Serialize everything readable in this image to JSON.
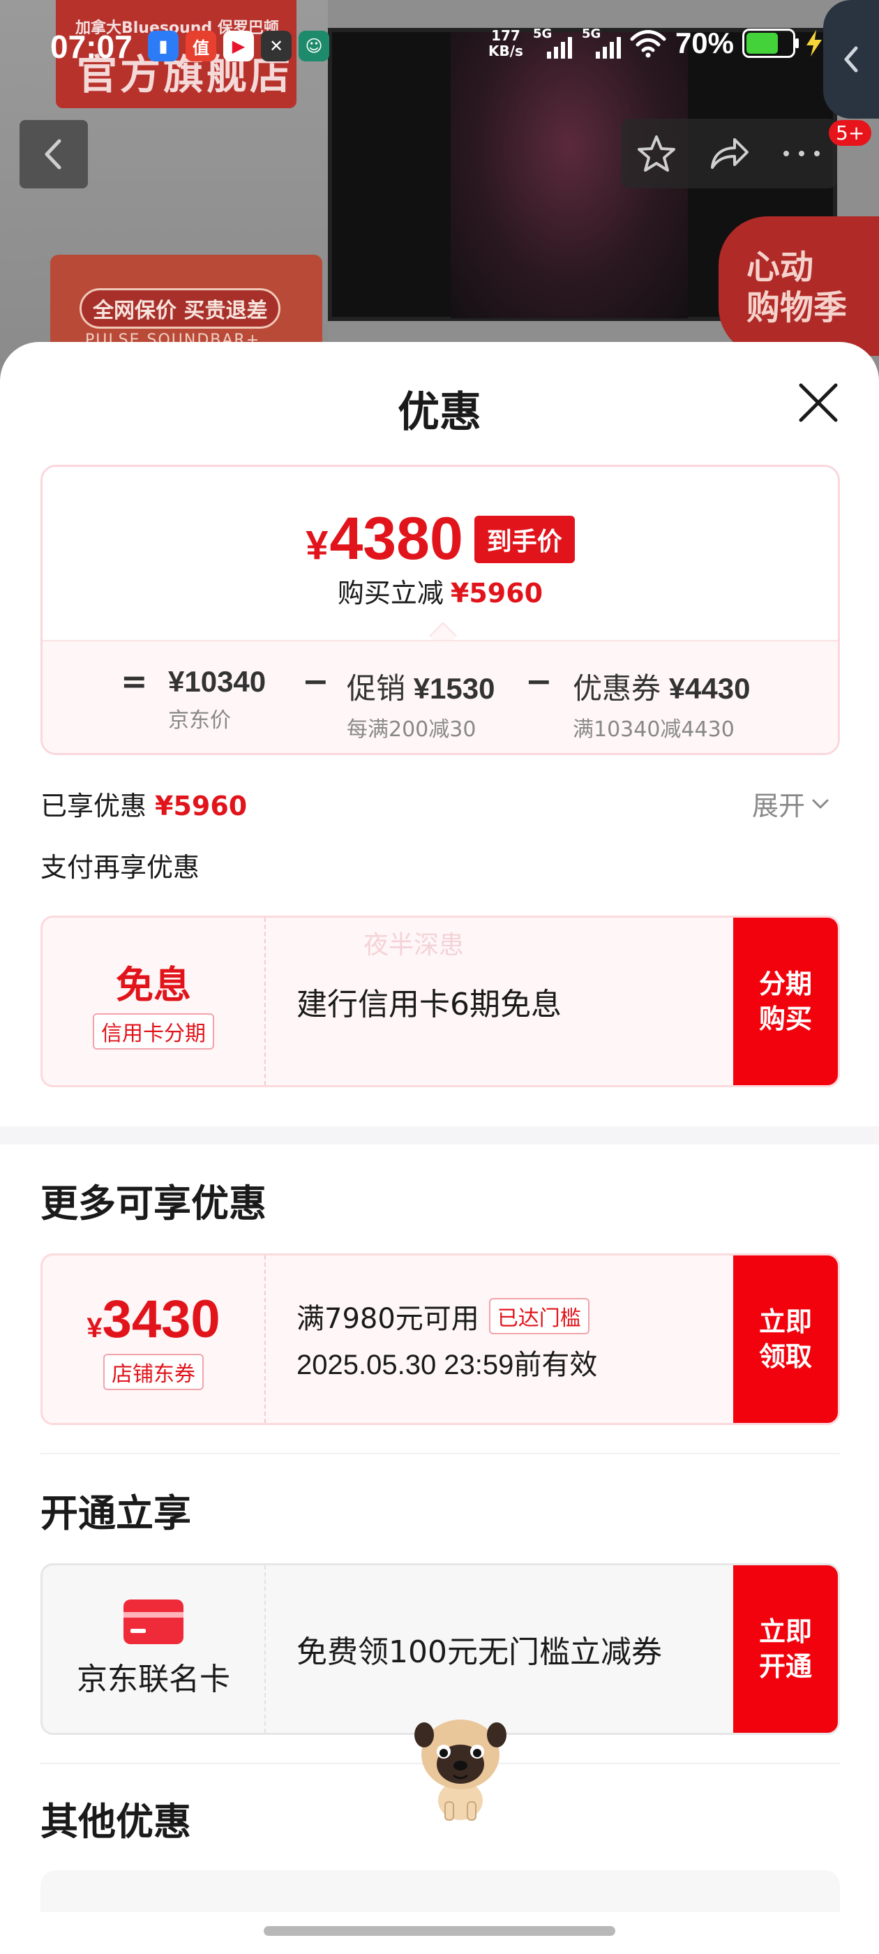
{
  "status_bar": {
    "time": "07:07",
    "net_speed_value": "177",
    "net_speed_unit": "KB/s",
    "signal_1": "5G",
    "signal_2": "5G",
    "battery_pct": "70%",
    "battery_level": 0.7
  },
  "background_page": {
    "store_banner_small": "加拿大Bluesound 保罗巴顿",
    "store_banner_big": "官方旗舰店",
    "promo_pill": "全网保价 买贵退差",
    "promo_sub": "PULSE SOUNDBAR+",
    "heart_text_1": "心动",
    "heart_text_2": "购物季",
    "badge": "5+"
  },
  "sheet": {
    "title": "优惠"
  },
  "price_card": {
    "currency": "¥",
    "final_price": "4380",
    "final_tag": "到手价",
    "sub_label": "购买立减",
    "sub_value": "¥5960",
    "breakdown": {
      "eq": "=",
      "minus": "−",
      "jd_price": "¥10340",
      "jd_label": "京东价",
      "promo_label": "促销",
      "promo_value": "¥1530",
      "promo_desc": "每满200减30",
      "coupon_label": "优惠券",
      "coupon_value": "¥4430",
      "coupon_desc": "满10340减4430"
    }
  },
  "enjoyed": {
    "label": "已享优惠",
    "value": "¥5960",
    "expand": "展开"
  },
  "pay_more": {
    "title": "支付再享优惠",
    "watermark": "夜半深患",
    "free_title": "免息",
    "free_tag": "信用卡分期",
    "desc": "建行信用卡6期免息",
    "action": "分期购买"
  },
  "more_offers": {
    "title": "更多可享优惠",
    "currency": "¥",
    "amount": "3430",
    "tag": "店铺东券",
    "condition": "满7980元可用",
    "reached": "已达门槛",
    "valid_until": "2025.05.30 23:59前有效",
    "action": "立即领取"
  },
  "open_enjoy": {
    "title": "开通立享",
    "card_name": "京东联名卡",
    "desc": "免费领100元无门槛立减券",
    "action": "立即开通"
  },
  "other": {
    "title": "其他优惠"
  },
  "colors": {
    "accent": "#e1141b",
    "button_red": "#f2020d",
    "card_bg": "#fff6f7"
  }
}
